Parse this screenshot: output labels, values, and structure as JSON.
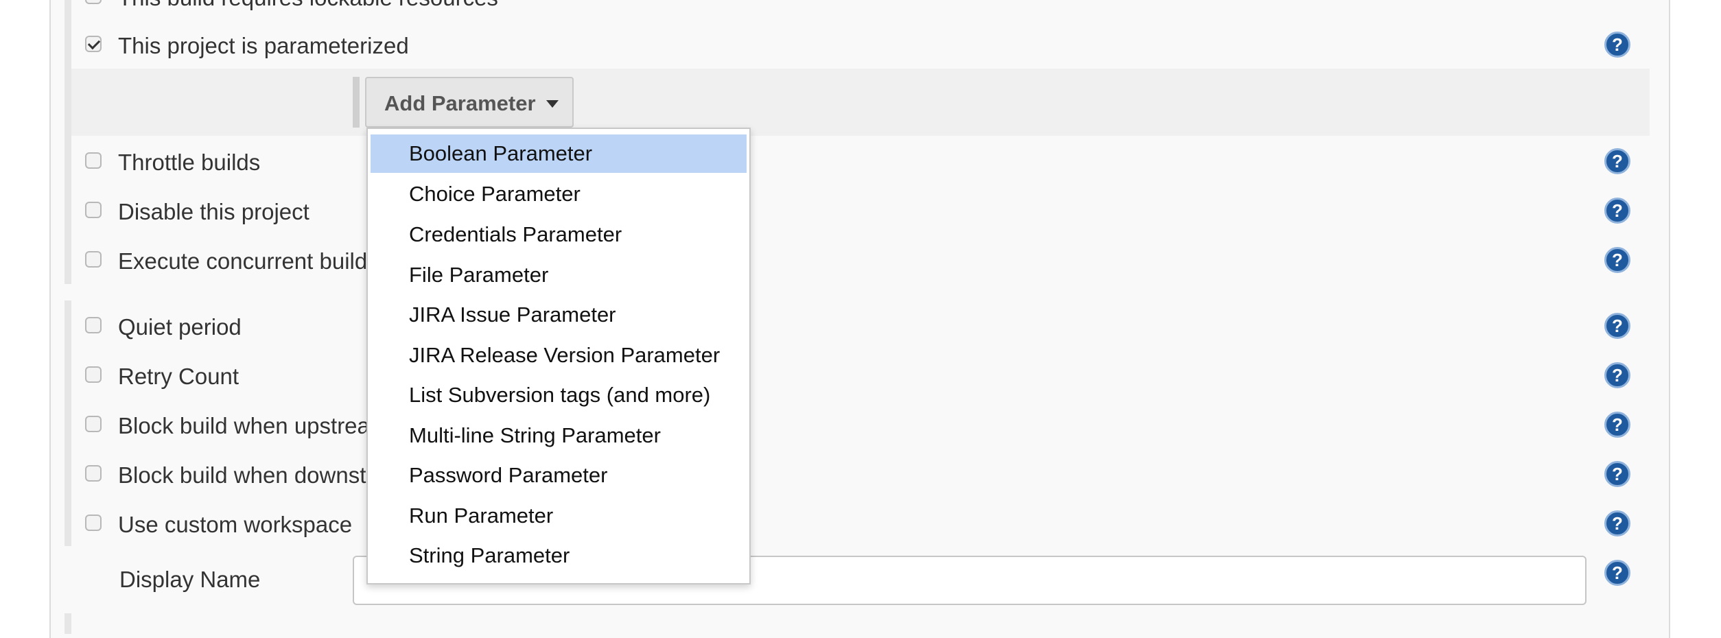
{
  "options": [
    {
      "id": "lockable",
      "label": "This build requires lockable resources",
      "checked": false
    },
    {
      "id": "parameterized",
      "label": "This project is parameterized",
      "checked": true
    },
    {
      "id": "throttle",
      "label": "Throttle builds",
      "checked": false
    },
    {
      "id": "disable",
      "label": "Disable this project",
      "checked": false
    },
    {
      "id": "concurrent",
      "label": "Execute concurrent builds if necessary",
      "checked": false
    },
    {
      "id": "quiet",
      "label": "Quiet period",
      "checked": false
    },
    {
      "id": "retry",
      "label": "Retry Count",
      "checked": false
    },
    {
      "id": "block_up",
      "label": "Block build when upstream project is building",
      "checked": false
    },
    {
      "id": "block_down",
      "label": "Block build when downstream project is building",
      "checked": false
    },
    {
      "id": "workspace",
      "label": "Use custom workspace",
      "checked": false
    }
  ],
  "add_parameter": {
    "button_label": "Add Parameter",
    "menu_items": [
      "Boolean Parameter",
      "Choice Parameter",
      "Credentials Parameter",
      "File Parameter",
      "JIRA Issue Parameter",
      "JIRA Release Version Parameter",
      "List Subversion tags (and more)",
      "Multi-line String Parameter",
      "Password Parameter",
      "Run Parameter",
      "String Parameter"
    ],
    "highlighted_index": 0
  },
  "display_name": {
    "label": "Display Name",
    "value": ""
  },
  "help_icon": {
    "glyph": "?",
    "name": "help-icon"
  },
  "colors": {
    "highlight": "#bcd5f7",
    "help": "#1f5a9e"
  }
}
